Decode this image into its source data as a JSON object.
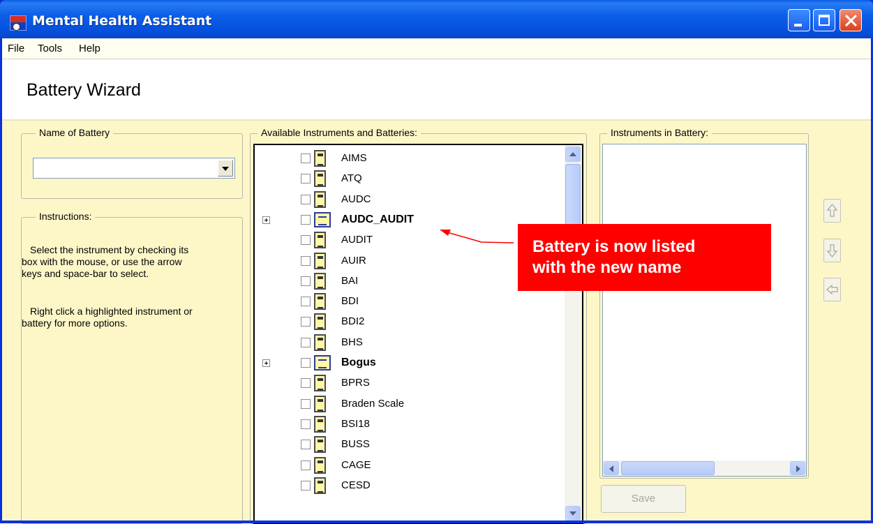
{
  "window": {
    "title": "Mental Health Assistant"
  },
  "menu": {
    "items": [
      "File",
      "Tools",
      "Help"
    ]
  },
  "header": {
    "title": "Battery Wizard"
  },
  "name_group": {
    "label": "Name of Battery",
    "value": ""
  },
  "instructions": {
    "label": "Instructions:",
    "paragraph1": [
      "Select the instrument by checking its",
      "box with the mouse, or use the arrow",
      "keys and space-bar to select."
    ],
    "paragraph2": [
      "Right click a highlighted instrument or",
      "battery for more options."
    ]
  },
  "available": {
    "label": "Available Instruments and Batteries:",
    "items": [
      {
        "label": "AIMS",
        "type": "instrument",
        "expandable": false
      },
      {
        "label": "ATQ",
        "type": "instrument",
        "expandable": false
      },
      {
        "label": "AUDC",
        "type": "instrument",
        "expandable": false
      },
      {
        "label": "AUDC_AUDIT",
        "type": "battery",
        "expandable": true
      },
      {
        "label": "AUDIT",
        "type": "instrument",
        "expandable": false
      },
      {
        "label": "AUIR",
        "type": "instrument",
        "expandable": false
      },
      {
        "label": "BAI",
        "type": "instrument",
        "expandable": false
      },
      {
        "label": "BDI",
        "type": "instrument",
        "expandable": false
      },
      {
        "label": "BDI2",
        "type": "instrument",
        "expandable": false
      },
      {
        "label": "BHS",
        "type": "instrument",
        "expandable": false
      },
      {
        "label": "Bogus",
        "type": "battery",
        "expandable": true
      },
      {
        "label": "BPRS",
        "type": "instrument",
        "expandable": false
      },
      {
        "label": "Braden Scale",
        "type": "instrument",
        "expandable": false
      },
      {
        "label": "BSI18",
        "type": "instrument",
        "expandable": false
      },
      {
        "label": "BUSS",
        "type": "instrument",
        "expandable": false
      },
      {
        "label": "CAGE",
        "type": "instrument",
        "expandable": false
      },
      {
        "label": "CESD",
        "type": "instrument",
        "expandable": false
      }
    ]
  },
  "in_battery": {
    "label": "Instruments in Battery:",
    "items": []
  },
  "buttons": {
    "save": "Save"
  },
  "callout": {
    "line1": "Battery is now listed",
    "line2": "with the new name",
    "color": "#ff0000"
  },
  "colors": {
    "titlebar": "#0a5ae8",
    "panel": "#fdf7c8"
  }
}
